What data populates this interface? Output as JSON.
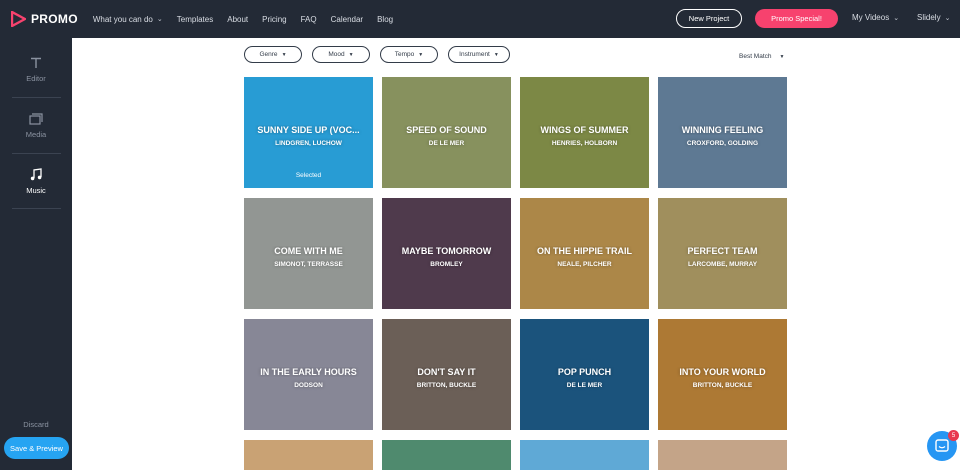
{
  "header": {
    "logo_text": "PROMO",
    "nav": [
      {
        "label": "What you can do",
        "has_dropdown": true
      },
      {
        "label": "Templates"
      },
      {
        "label": "About"
      },
      {
        "label": "Pricing"
      },
      {
        "label": "FAQ"
      },
      {
        "label": "Calendar"
      },
      {
        "label": "Blog"
      }
    ],
    "new_project_label": "New Project",
    "promo_special_label": "Promo Special!",
    "my_videos_label": "My Videos",
    "account_label": "Slidely"
  },
  "sidebar": {
    "items": [
      {
        "label": "Editor",
        "icon": "text-t-icon"
      },
      {
        "label": "Media",
        "icon": "media-stack-icon"
      },
      {
        "label": "Music",
        "icon": "music-note-icon",
        "active": true
      }
    ],
    "discard_label": "Discard",
    "save_label": "Save & Preview"
  },
  "filters": {
    "genre": "Genre",
    "mood": "Mood",
    "tempo": "Tempo",
    "instrument": "Instrument",
    "sort": "Best Match"
  },
  "tracks": [
    {
      "title": "SUNNY SIDE UP (VOC...",
      "artist": "LINDGREN, LUCHOW",
      "selected_label": "Selected",
      "bg": "#2eb2f2"
    },
    {
      "title": "SPEED OF SOUND",
      "artist": "DE LE MER",
      "bg": "#9aa56c"
    },
    {
      "title": "WINGS OF SUMMER",
      "artist": "HENRIES, HOLBORN",
      "bg": "#8e9b4f"
    },
    {
      "title": "WINNING FEELING",
      "artist": "CROXFORD, GOLDING",
      "bg": "#6b8aa8"
    },
    {
      "title": "COME WITH ME",
      "artist": "SIMONOT, TERRASSE",
      "bg": "#a7aba8"
    },
    {
      "title": "MAYBE TOMORROW",
      "artist": "BROMLEY",
      "bg": "#5a4257"
    },
    {
      "title": "ON THE HIPPIE TRAIL",
      "artist": "NEALE, PILCHER",
      "bg": "#c49a52"
    },
    {
      "title": "PERFECT TEAM",
      "artist": "LARCOMBE, MURRAY",
      "bg": "#b7a36a"
    },
    {
      "title": "IN THE EARLY HOURS",
      "artist": "DODSON",
      "bg": "#9a9aab"
    },
    {
      "title": "DON'T SAY IT",
      "artist": "BRITTON, BUCKLE",
      "bg": "#7a6d63"
    },
    {
      "title": "POP PUNCH",
      "artist": "DE LE MER",
      "bg": "#1f5f8e"
    },
    {
      "title": "INTO YOUR WORLD",
      "artist": "BRITTON, BUCKLE",
      "bg": "#c58a3c"
    },
    {
      "title": "",
      "artist": "",
      "bg": "#c9a274"
    },
    {
      "title": "",
      "artist": "",
      "bg": "#4f8a6e"
    },
    {
      "title": "",
      "artist": "",
      "bg": "#5fa9d6"
    },
    {
      "title": "",
      "artist": "",
      "bg": "#c4a488"
    }
  ],
  "chat": {
    "badge": "5"
  },
  "colors": {
    "dark": "#232a36",
    "accent_pink": "#f7426e",
    "accent_blue": "#26a4f2"
  }
}
